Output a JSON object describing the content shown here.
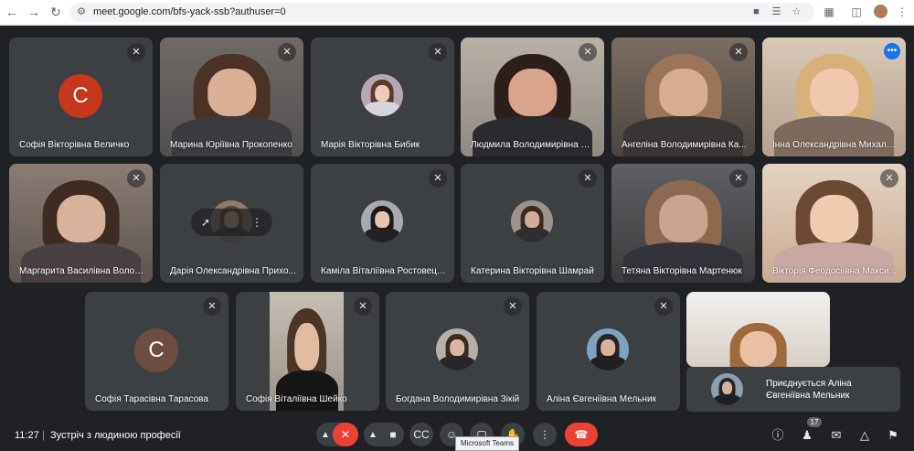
{
  "browser": {
    "url": "meet.google.com/bfs-yack-ssb?authuser=0"
  },
  "tiles": [
    {
      "name": "Софія Вікторівна Величко",
      "initial": "С",
      "color": "#c5361b"
    },
    {
      "name": "Марина Юріївна Прокопенко"
    },
    {
      "name": "Марія Вікторівна Бибик"
    },
    {
      "name": "Людмила Володимирівна Ма..."
    },
    {
      "name": "Ангеліна Володимирівна Ка..."
    },
    {
      "name": "Інна Олександрівна Михале..."
    },
    {
      "name": "Маргарита Василівна Волон..."
    },
    {
      "name": "Дарія Олександрівна Прихо..."
    },
    {
      "name": "Каміла Віталіївна Ростовецька"
    },
    {
      "name": "Катерина Вікторівна Шамрай"
    },
    {
      "name": "Тетяна Вікторівна Мартенюк"
    },
    {
      "name": "Вікторія Феодосіївна Макси..."
    },
    {
      "name": "Софія Тарасівна Тарасова",
      "initial": "С",
      "color": "#6d4c41"
    },
    {
      "name": "Софія Віталіївна Шейко"
    },
    {
      "name": "Богдана Володимирівна Зікій"
    },
    {
      "name": "Аліна Євгеніївна Мельник"
    }
  ],
  "toast": {
    "text": "Приєднується Аліна Євгеніївна Мельник"
  },
  "bottom": {
    "time": "11:27",
    "separator": "|",
    "meeting_title": "Зустріч з людиною професії",
    "participants_count": "17",
    "tooltip": "Microsoft Teams"
  }
}
